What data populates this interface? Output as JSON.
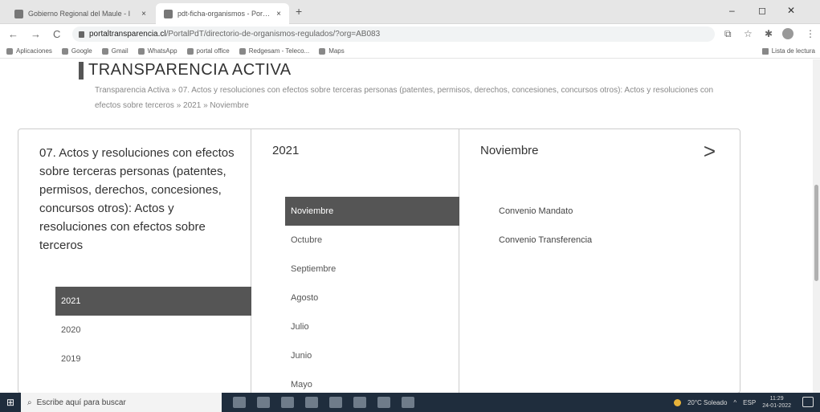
{
  "browser": {
    "tabs": [
      {
        "title": "Gobierno Regional del Maule - I",
        "close": "×"
      },
      {
        "title": "pdt-ficha-organismos - Portal de",
        "close": "×"
      }
    ],
    "new_tab": "+",
    "window_controls": {
      "minimize": "–",
      "maximize": "◻",
      "close": "✕"
    },
    "nav": {
      "back": "←",
      "forward": "→",
      "reload": "C"
    },
    "url": {
      "host": "portaltransparencia.cl",
      "path": "/PortalPdT/directorio-de-organismos-regulados/?org=AB083"
    },
    "address_icons": {
      "share": "⧉",
      "star": "☆",
      "extensions": "✱",
      "menu": "⋮"
    },
    "bookmarks": [
      "Aplicaciones",
      "Google",
      "Gmail",
      "WhatsApp",
      "portal office",
      "Redgesam - Teleco...",
      "Maps"
    ],
    "reading_list": "Lista de lectura"
  },
  "page": {
    "title": "TRANSPARENCIA ACTIVA",
    "breadcrumb": "Transparencia Activa » 07. Actos y resoluciones con efectos sobre terceras personas (patentes, permisos, derechos, concesiones, concursos otros): Actos y resoluciones con efectos sobre terceros » 2021 » Noviembre"
  },
  "panel": {
    "category_title": "07. Actos y resoluciones con efectos sobre terceras personas (patentes, permisos, derechos, concesiones, concursos otros): Actos y resoluciones con efectos sobre terceros",
    "years": [
      {
        "label": "2021",
        "selected": true
      },
      {
        "label": "2020",
        "selected": false
      },
      {
        "label": "2019",
        "selected": false
      }
    ],
    "year_header": "2021",
    "months": [
      {
        "label": "Noviembre",
        "selected": true
      },
      {
        "label": "Octubre",
        "selected": false
      },
      {
        "label": "Septiembre",
        "selected": false
      },
      {
        "label": "Agosto",
        "selected": false
      },
      {
        "label": "Julio",
        "selected": false
      },
      {
        "label": "Junio",
        "selected": false
      },
      {
        "label": "Mayo",
        "selected": false
      }
    ],
    "month_header": "Noviembre",
    "next_arrow": ">",
    "documents": [
      "Convenio Mandato",
      "Convenio Transferencia"
    ]
  },
  "taskbar": {
    "start_icon": "⊞",
    "search_icon": "⌕",
    "search_placeholder": "Escribe aquí para buscar",
    "weather": "20°C  Soleado",
    "language": "ESP",
    "time": "11:29",
    "date": "24-01-2022"
  }
}
